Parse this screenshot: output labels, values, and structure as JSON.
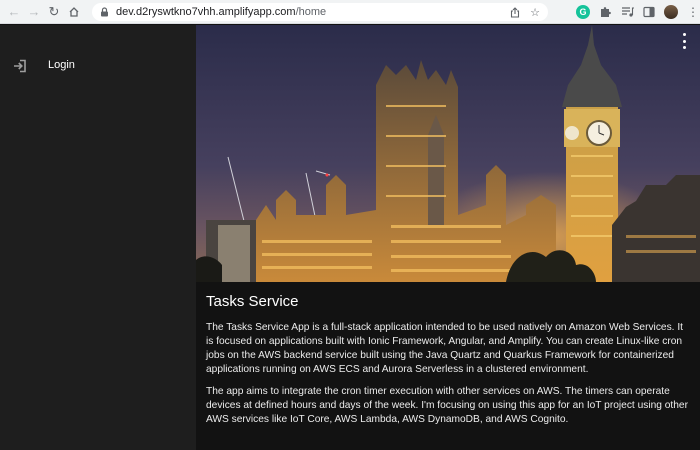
{
  "browser": {
    "url_host": "dev.d2ryswtkno7vhh.amplifyapp.com",
    "url_path": "/home",
    "extensions": [
      "grammarly-icon",
      "puzzle-icon",
      "media-icon",
      "sidepanel-icon"
    ]
  },
  "sidebar": {
    "items": [
      {
        "label": "Login",
        "icon": "login-icon"
      }
    ]
  },
  "main": {
    "hero_image": "big-ben-night-photo",
    "title": "Tasks Service",
    "paragraphs": [
      "The Tasks Service App is a full-stack application intended to be used natively on Amazon Web Services. It is focused on applications built with Ionic Framework, Angular, and Amplify. You can create Linux-like cron jobs on the AWS backend service built using the Java Quartz and Quarkus Framework for containerized applications running on AWS ECS and Aurora Serverless in a clustered environment.",
      "The app aims to integrate the cron timer execution with other services on AWS. The timers can operate devices at defined hours and days of the week. I'm focusing on using this app for an IoT project using other AWS services like IoT Core, AWS Lambda, AWS DynamoDB, and AWS Cognito."
    ]
  },
  "colors": {
    "sidebar_bg": "#1e1e1e",
    "content_bg": "#121212",
    "text": "#ffffff"
  }
}
